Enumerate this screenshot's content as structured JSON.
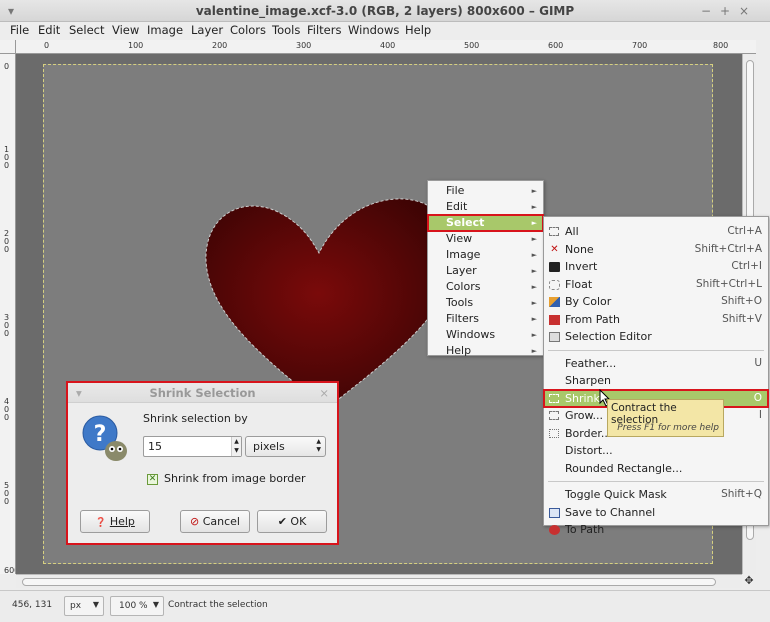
{
  "window": {
    "title": "valentine_image.xcf-3.0 (RGB, 2 layers) 800x600 – GIMP",
    "left_glyph": "▾",
    "min_glyph": "−",
    "max_glyph": "+",
    "close_glyph": "×"
  },
  "menubar": [
    "File",
    "Edit",
    "Select",
    "View",
    "Image",
    "Layer",
    "Colors",
    "Tools",
    "Filters",
    "Windows",
    "Help"
  ],
  "ruler_top": [
    "0",
    "100",
    "200",
    "300",
    "400",
    "500",
    "600",
    "700",
    "800"
  ],
  "ruler_left": [
    "0",
    "100",
    "200",
    "300",
    "400",
    "500",
    "600"
  ],
  "context_menu": [
    {
      "label": "File",
      "arrow": "►"
    },
    {
      "label": "Edit",
      "arrow": "►"
    },
    {
      "label": "Select",
      "arrow": "►"
    },
    {
      "label": "View",
      "arrow": "►"
    },
    {
      "label": "Image",
      "arrow": "►"
    },
    {
      "label": "Layer",
      "arrow": "►"
    },
    {
      "label": "Colors",
      "arrow": "►"
    },
    {
      "label": "Tools",
      "arrow": "►"
    },
    {
      "label": "Filters",
      "arrow": "►"
    },
    {
      "label": "Windows",
      "arrow": "►"
    },
    {
      "label": "Help",
      "arrow": "►"
    }
  ],
  "select_submenu": {
    "group1": [
      {
        "label": "All",
        "shortcut": "Ctrl+A",
        "icon": "select-all-icon"
      },
      {
        "label": "None",
        "shortcut": "Shift+Ctrl+A",
        "icon": "select-none-icon"
      },
      {
        "label": "Invert",
        "shortcut": "Ctrl+I",
        "icon": "invert-icon"
      },
      {
        "label": "Float",
        "shortcut": "Shift+Ctrl+L",
        "icon": "float-icon"
      },
      {
        "label": "By Color",
        "shortcut": "Shift+O",
        "icon": "by-color-icon"
      },
      {
        "label": "From Path",
        "shortcut": "Shift+V",
        "icon": "from-path-icon"
      },
      {
        "label": "Selection Editor",
        "shortcut": "",
        "icon": "selection-editor-icon"
      }
    ],
    "group2": [
      {
        "label": "Feather...",
        "shortcut": "U"
      },
      {
        "label": "Sharpen",
        "shortcut": ""
      },
      {
        "label": "Shrink...",
        "shortcut": "O"
      },
      {
        "label": "Grow...",
        "shortcut": "I"
      },
      {
        "label": "Border...",
        "shortcut": ""
      },
      {
        "label": "Distort...",
        "shortcut": ""
      },
      {
        "label": "Rounded Rectangle...",
        "shortcut": ""
      }
    ],
    "group3": [
      {
        "label": "Toggle Quick Mask",
        "shortcut": "Shift+Q"
      },
      {
        "label": "Save to Channel",
        "shortcut": ""
      },
      {
        "label": "To Path",
        "shortcut": ""
      }
    ]
  },
  "tooltip": {
    "text": "Contract the selection",
    "hint": "Press F1 for more help"
  },
  "dialog": {
    "title": "Shrink Selection",
    "prompt": "Shrink selection by",
    "value": "15",
    "unit": "pixels",
    "checkbox_label": "Shrink from image border",
    "checked": true,
    "help": "Help",
    "cancel": "Cancel",
    "ok": "OK"
  },
  "status": {
    "coords": "456, 131",
    "unit": "px",
    "zoom": "100 %",
    "message": "Contract the selection"
  },
  "colors": {
    "highlight": "#a8c86a",
    "callout": "#d8141c",
    "heart": "#6b0808"
  }
}
